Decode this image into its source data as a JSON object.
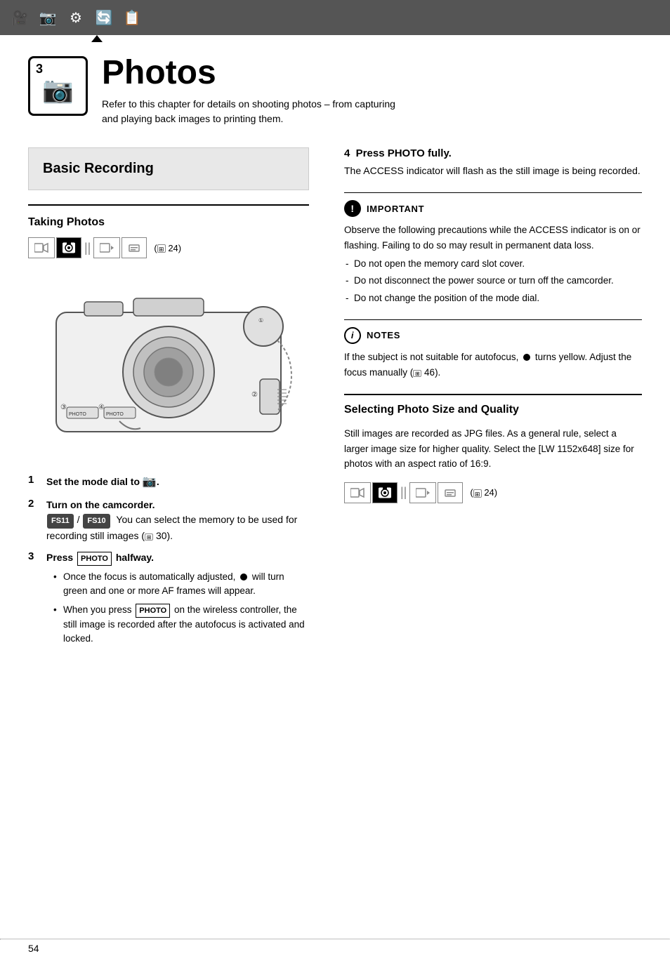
{
  "topnav": {
    "icons": [
      "🎥",
      "📷",
      "⚙",
      "🔄",
      "📋"
    ],
    "arrow_indicator": true
  },
  "chapter": {
    "number": "3",
    "title": "Photos",
    "icon": "📷",
    "description": "Refer to this chapter for details on shooting photos – from capturing\nand playing back images to printing them."
  },
  "basic_recording": {
    "label": "Basic Recording"
  },
  "taking_photos": {
    "section_title": "Taking Photos",
    "mode_ref": "( 24)",
    "steps": [
      {
        "num": "1",
        "text": "Set the mode dial to",
        "icon": "📷",
        "period": "."
      },
      {
        "num": "2",
        "text": "Turn on the camcorder.",
        "subtext": "You can select the memory to be used for recording still images (",
        "ref": "30",
        "ref_end": ")."
      },
      {
        "num": "3",
        "text": "Press",
        "badge": "PHOTO",
        "text2": "halfway.",
        "bullets": [
          "Once the focus is automatically adjusted, ● will turn green and one or more AF frames will appear.",
          "When you press PHOTO on the wireless controller, the still image is recorded after the autofocus is activated and locked."
        ]
      }
    ]
  },
  "step4": {
    "num": "4",
    "label": "Press",
    "badge": "PHOTO",
    "text": "fully.",
    "body": "The ACCESS indicator will flash as the still image is being recorded."
  },
  "important": {
    "header": "IMPORTANT",
    "body": "Observe the following precautions while the ACCESS indicator is on or flashing. Failing to do so may result in permanent data loss.",
    "list": [
      "Do not open the memory card slot cover.",
      "Do not disconnect the power source or turn off the camcorder.",
      "Do not change the position of the mode dial."
    ]
  },
  "notes": {
    "header": "NOTES",
    "body": "If the subject is not suitable for autofocus, ● turns yellow. Adjust the focus manually ( 46)."
  },
  "selecting_photo": {
    "section_title": "Selecting Photo Size and Quality",
    "body": "Still images are recorded as JPG files. As a general rule, select a larger image size for higher quality. Select the [LW 1152x648] size for photos with an aspect ratio of 16:9.",
    "mode_ref": "( 24)"
  },
  "page_number": "54"
}
